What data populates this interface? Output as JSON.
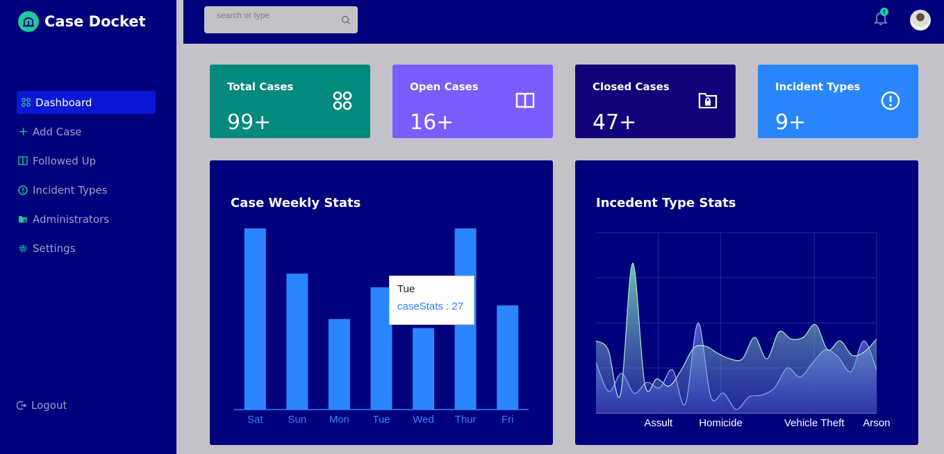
{
  "app": {
    "name": "Case Docket"
  },
  "sidebar": {
    "items": [
      {
        "label": "Dashboard",
        "icon": "grid-icon",
        "active": true
      },
      {
        "label": "Add Case",
        "icon": "plus-icon"
      },
      {
        "label": "Followed Up",
        "icon": "folder-book-icon"
      },
      {
        "label": "Incident Types",
        "icon": "alert-circle-icon"
      },
      {
        "label": "Administrators",
        "icon": "folder-user-icon"
      },
      {
        "label": "Settings",
        "icon": "gear-icon"
      }
    ],
    "logout": "Logout"
  },
  "topbar": {
    "search_placeholder": "search or type",
    "notification_count": "!"
  },
  "stats": [
    {
      "title": "Total Cases",
      "value": "99+",
      "color": "#028a7e",
      "icon": "four-circles-icon"
    },
    {
      "title": "Open Cases",
      "value": "16+",
      "color": "#7b5cff",
      "icon": "open-book-icon"
    },
    {
      "title": "Closed Cases",
      "value": "47+",
      "color": "#11017a",
      "icon": "folder-lock-icon"
    },
    {
      "title": "Incident Types",
      "value": "9+",
      "color": "#2a86ff",
      "icon": "alert-circle-icon"
    }
  ],
  "charts": {
    "weekly": {
      "title": "Case Weekly Stats",
      "tooltip": {
        "label": "Tue",
        "value": "caseStats : 27"
      }
    },
    "incident": {
      "title": "Incedent Type Stats"
    }
  },
  "chart_data": [
    {
      "type": "bar",
      "title": "Case Weekly Stats",
      "categories": [
        "Sat",
        "Sun",
        "Mon",
        "Tue",
        "Wed",
        "Thur",
        "Fri"
      ],
      "series": [
        {
          "name": "caseStats",
          "values": [
            40,
            30,
            20,
            27,
            18,
            40,
            23
          ]
        }
      ],
      "ylim": [
        0,
        40
      ],
      "bar_color": "#2a86ff"
    },
    {
      "type": "area",
      "title": "Incedent Type Stats",
      "categories": [
        "Assult",
        "Homicide",
        "Vehicle Theft",
        "Arson"
      ],
      "x_positions": [
        0.5,
        1,
        1.75,
        2.25
      ],
      "x_range": [
        0,
        2.25
      ],
      "series": [
        {
          "values": [
            28,
            12,
            22,
            11,
            17,
            14,
            24,
            5,
            50,
            9,
            11,
            2,
            9,
            10,
            14,
            25,
            20,
            28,
            35,
            31,
            23,
            40,
            24
          ],
          "front": false
        },
        {
          "values": [
            40,
            35,
            10,
            83,
            16,
            19,
            15,
            24,
            36,
            37,
            33,
            30,
            30,
            42,
            30,
            45,
            41,
            42,
            49,
            35,
            40,
            32,
            34,
            41
          ],
          "front": true
        }
      ]
    }
  ]
}
